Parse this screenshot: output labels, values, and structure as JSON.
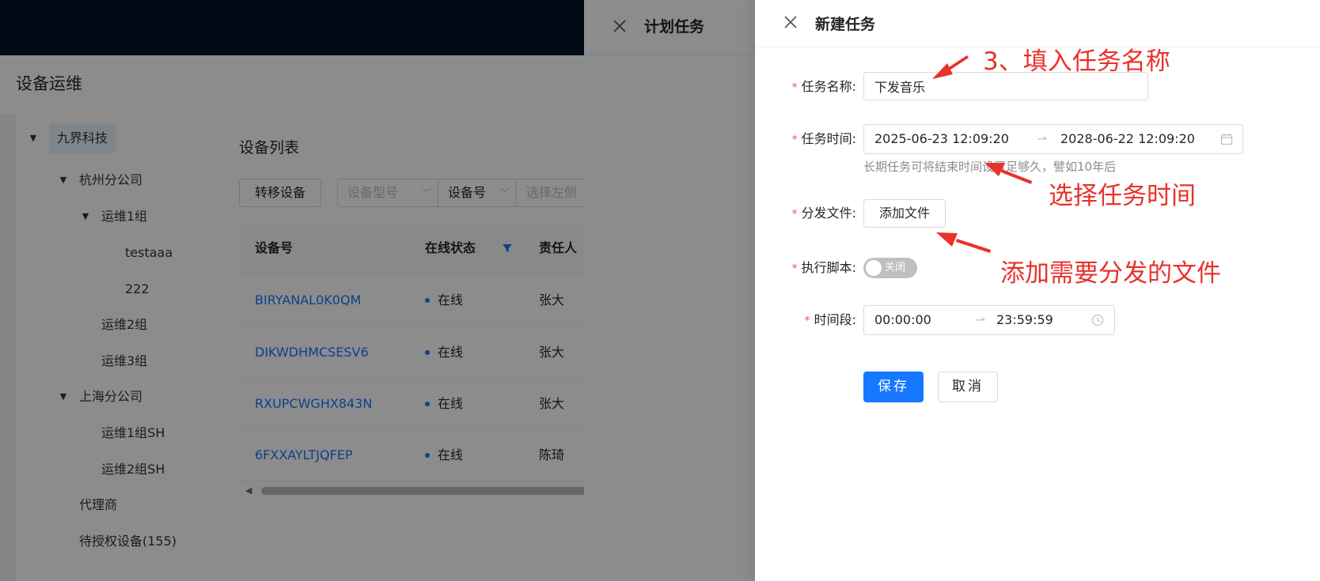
{
  "app": {
    "page_title": "设备运维"
  },
  "tree": {
    "nodes": [
      {
        "label": "九界科技",
        "expanded": true,
        "selected": true
      },
      {
        "label": "杭州分公司",
        "expanded": true
      },
      {
        "label": "运维1组",
        "expanded": true
      },
      {
        "label": "testaaa"
      },
      {
        "label": "222"
      },
      {
        "label": "运维2组"
      },
      {
        "label": "运维3组"
      },
      {
        "label": "上海分公司",
        "expanded": true
      },
      {
        "label": "运维1组SH"
      },
      {
        "label": "运维2组SH"
      },
      {
        "label": "代理商"
      },
      {
        "label": "待授权设备(155)"
      }
    ]
  },
  "device_list": {
    "title": "设备列表",
    "transfer_button": "转移设备",
    "filters": {
      "model_placeholder": "设备型号",
      "field_select": "设备号",
      "search_placeholder": "选择左侧"
    },
    "columns": [
      "设备号",
      "在线状态",
      "责任人"
    ],
    "rows": [
      {
        "device_id": "BIRYANAL0K0QM",
        "status": "在线",
        "owner": "张大"
      },
      {
        "device_id": "DIKWDHMCSESV6",
        "status": "在线",
        "owner": "张大"
      },
      {
        "device_id": "RXUPCWGHX843N",
        "status": "在线",
        "owner": "张大"
      },
      {
        "device_id": "6FXXAYLTJQFEP",
        "status": "在线",
        "owner": "陈琦"
      }
    ]
  },
  "plan_drawer": {
    "title": "计划任务"
  },
  "new_task_drawer": {
    "title": "新建任务",
    "fields": {
      "name_label": "任务名称:",
      "name_value": "下发音乐",
      "time_label": "任务时间:",
      "time_start": "2025-06-23 12:09:20",
      "time_end": "2028-06-22 12:09:20",
      "time_hint": "长期任务可将结束时间设置足够久，譬如10年后",
      "file_label": "分发文件:",
      "file_button": "添加文件",
      "script_label": "执行脚本:",
      "script_switch_text": "关闭",
      "script_enabled": false,
      "period_label": "时间段:",
      "period_start": "00:00:00",
      "period_end": "23:59:59"
    },
    "save_button": "保存",
    "cancel_button": "取消"
  },
  "annotations": {
    "fill_name": "3、填入任务名称",
    "select_time": "选择任务时间",
    "add_file": "添加需要分发的文件"
  },
  "colors": {
    "primary": "#1677ff",
    "required": "#ff4d4f",
    "annotation": "#e8322a",
    "topbar": "#001529"
  }
}
